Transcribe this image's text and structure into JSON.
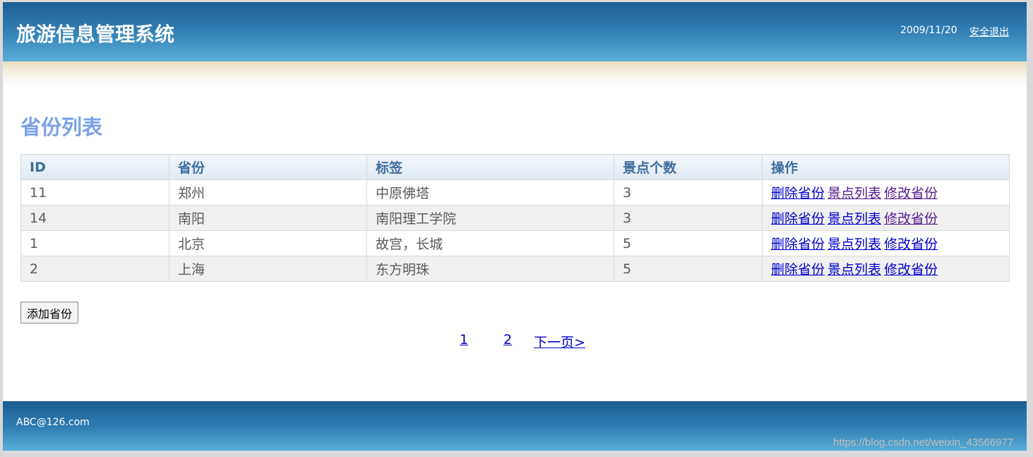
{
  "header": {
    "title": "旅游信息管理系统",
    "date": "2009/11/20",
    "logout_label": "安全退出"
  },
  "main": {
    "page_title": "省份列表",
    "table": {
      "columns": [
        "ID",
        "省份",
        "标签",
        "景点个数",
        "操作"
      ],
      "rows": [
        {
          "id": "11",
          "province": "郑州",
          "tags": "中原佛塔",
          "count": "3"
        },
        {
          "id": "14",
          "province": "南阳",
          "tags": "南阳理工学院",
          "count": "3"
        },
        {
          "id": "1",
          "province": "北京",
          "tags": "故宫，长城",
          "count": "5"
        },
        {
          "id": "2",
          "province": "上海",
          "tags": "东方明珠",
          "count": "5"
        }
      ],
      "actions": {
        "delete": "删除省份",
        "list": "景点列表",
        "edit": "修改省份"
      }
    },
    "add_button_label": "添加省份",
    "pagination": {
      "pages": [
        "1",
        "2"
      ],
      "next_label": "下一页>"
    }
  },
  "footer": {
    "email": "ABC@126.com"
  },
  "watermark": "https://blog.csdn.net/weixin_43566977",
  "colors": {
    "header_top": "#1d5f95",
    "header_bottom": "#5aaed7",
    "page_title": "#7aa2e8",
    "table_header_text": "#3d6d9e",
    "link": "#0000cc",
    "visited_link": "#551a8b"
  }
}
